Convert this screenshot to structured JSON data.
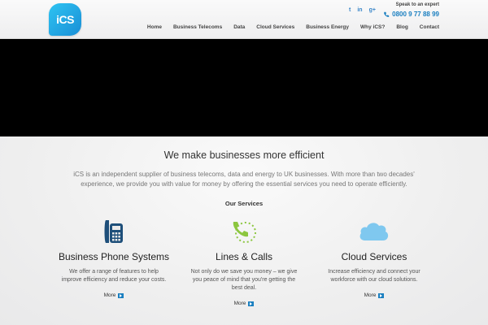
{
  "header": {
    "logo_text": "iCS",
    "speak_label": "Speak to an expert",
    "phone": "0800 9 77 88 99",
    "social": [
      {
        "icon": "twitter-icon",
        "glyph": "t"
      },
      {
        "icon": "linkedin-icon",
        "glyph": "in"
      },
      {
        "icon": "googleplus-icon",
        "glyph": "g+"
      }
    ],
    "nav": [
      "Home",
      "Business Telecoms",
      "Data",
      "Cloud Services",
      "Business Energy",
      "Why iCS?",
      "Blog",
      "Contact"
    ]
  },
  "main": {
    "headline": "We make businesses more efficient",
    "intro": "iCS is an independent supplier of business telecoms, data and energy to UK businesses. With more than two decades' experience, we provide you with value for money by offering the essential services you need to operate efficiently.",
    "services_title": "Our Services",
    "services": [
      {
        "title": "Business Phone Systems",
        "desc": "We offer a range of features to help improve efficiency and reduce your costs.",
        "more": "More",
        "icon": "desk-phone-icon"
      },
      {
        "title": "Lines & Calls",
        "desc": "Not only do we save you money – we give you peace of mind that you're getting the best deal.",
        "more": "More",
        "icon": "handset-icon"
      },
      {
        "title": "Cloud Services",
        "desc": "Increase efficiency and connect your workforce with our cloud solutions.",
        "more": "More",
        "icon": "cloud-icon"
      }
    ]
  },
  "colors": {
    "brand_blue": "#1a7fc0",
    "phone_icon": "#1e4f7a",
    "lines_icon": "#8cc63f",
    "cloud_icon": "#7fc8ef",
    "hero": "#000000"
  }
}
